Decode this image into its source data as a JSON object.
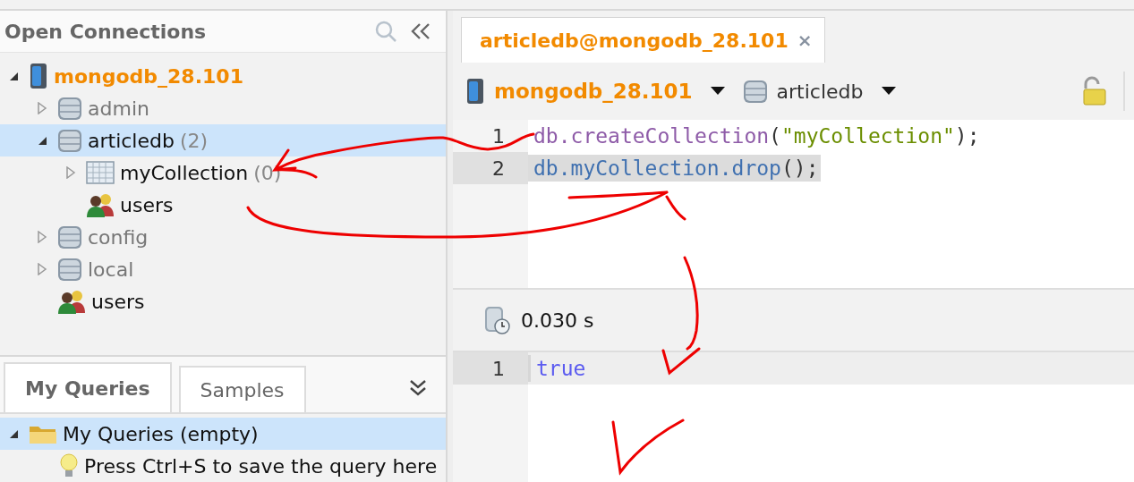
{
  "connections_panel": {
    "title": "Open Connections",
    "tree": [
      {
        "name": "mongodb_28.101",
        "kind": "connection",
        "expanded": true,
        "selected": false,
        "dimmed": false,
        "children": [
          {
            "name": "admin",
            "kind": "database",
            "expanded": false,
            "selected": false,
            "dimmed": true
          },
          {
            "name": "articledb",
            "count": "(2)",
            "kind": "database",
            "expanded": true,
            "selected": true,
            "dimmed": false,
            "children": [
              {
                "name": "myCollection",
                "count": "(0)",
                "kind": "collection",
                "expanded": false,
                "selected": false,
                "dimmed": false
              },
              {
                "name": "users",
                "kind": "users",
                "selected": false,
                "dimmed": false
              }
            ]
          },
          {
            "name": "config",
            "kind": "database",
            "expanded": false,
            "selected": false,
            "dimmed": true
          },
          {
            "name": "local",
            "kind": "database",
            "expanded": false,
            "selected": false,
            "dimmed": true
          },
          {
            "name": "users",
            "kind": "users",
            "selected": false,
            "dimmed": false
          }
        ]
      }
    ]
  },
  "queries_panel": {
    "tabs": [
      {
        "label": "My Queries",
        "selected": true
      },
      {
        "label": "Samples",
        "selected": false
      }
    ],
    "tree": [
      {
        "name": "My Queries (empty)",
        "kind": "folder",
        "expanded": true,
        "selected": true
      },
      {
        "name": "Press Ctrl+S to save the query here",
        "kind": "hint",
        "selected": false
      }
    ]
  },
  "editor_tabs": [
    {
      "label": "articledb@mongodb_28.101",
      "selected": true,
      "close": "×"
    }
  ],
  "toolbar": {
    "connection": "mongodb_28.101",
    "database": "articledb"
  },
  "editor": {
    "lines": [
      {
        "number": "1",
        "selected": false,
        "tokens": [
          {
            "text": "db.createCollection",
            "kind": "method"
          },
          {
            "text": "(",
            "kind": "punct"
          },
          {
            "text": "\"myCollection\"",
            "kind": "string"
          },
          {
            "text": ");",
            "kind": "punct"
          }
        ]
      },
      {
        "number": "2",
        "selected": true,
        "tokens": [
          {
            "text": "db.myCollection.drop",
            "kind": "call"
          },
          {
            "text": "();",
            "kind": "punct"
          }
        ]
      }
    ]
  },
  "result": {
    "time": "0.030 s",
    "lines": [
      {
        "number": "1",
        "selected": true,
        "tokens": [
          {
            "text": "true",
            "kind": "keyword"
          }
        ]
      }
    ]
  }
}
